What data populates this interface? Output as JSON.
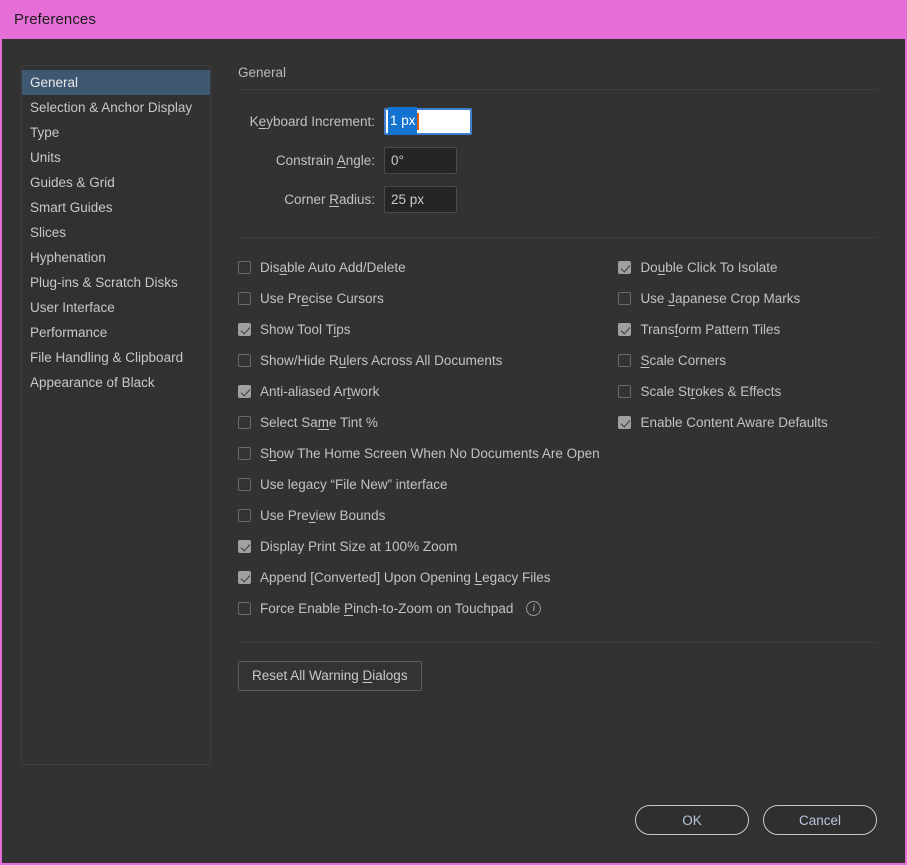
{
  "window": {
    "title": "Preferences",
    "titlebar_color": "#e56fd6",
    "background_color": "#323232",
    "accent_selection_color": "#3f5872",
    "focus_border_color": "#3f7fd0",
    "text_selection_color": "#1472d0",
    "caret_color": "#e06010"
  },
  "sidebar": {
    "items": [
      {
        "label": "General",
        "selected": true
      },
      {
        "label": "Selection & Anchor Display",
        "selected": false
      },
      {
        "label": "Type",
        "selected": false
      },
      {
        "label": "Units",
        "selected": false
      },
      {
        "label": "Guides & Grid",
        "selected": false
      },
      {
        "label": "Smart Guides",
        "selected": false
      },
      {
        "label": "Slices",
        "selected": false
      },
      {
        "label": "Hyphenation",
        "selected": false
      },
      {
        "label": "Plug-ins & Scratch Disks",
        "selected": false
      },
      {
        "label": "User Interface",
        "selected": false
      },
      {
        "label": "Performance",
        "selected": false
      },
      {
        "label": "File Handling & Clipboard",
        "selected": false
      },
      {
        "label": "Appearance of Black",
        "selected": false
      }
    ]
  },
  "pane": {
    "section_title": "General",
    "fields": [
      {
        "label_before": "K",
        "label_mnemonic": "e",
        "label_after": "yboard Increment:",
        "value": "1 px",
        "focused": true,
        "selected_text": "1 px"
      },
      {
        "label_before": "Constrain ",
        "label_mnemonic": "A",
        "label_after": "ngle:",
        "value": "0°",
        "focused": false
      },
      {
        "label_before": "Corner ",
        "label_mnemonic": "R",
        "label_after": "adius:",
        "value": "25 px",
        "focused": false
      }
    ],
    "checkboxes_left": [
      {
        "before": "Dis",
        "mnemonic": "a",
        "after": "ble Auto Add/Delete",
        "checked": false
      },
      {
        "before": "Use Pr",
        "mnemonic": "e",
        "after": "cise Cursors",
        "checked": false
      },
      {
        "before": "Show Tool T",
        "mnemonic": "i",
        "after": "ps",
        "checked": true
      },
      {
        "before": "Show/Hide R",
        "mnemonic": "u",
        "after": "lers Across All Documents",
        "checked": false
      },
      {
        "before": "Anti-aliased Ar",
        "mnemonic": "t",
        "after": "work",
        "checked": true
      },
      {
        "before": "Select Sa",
        "mnemonic": "m",
        "after": "e Tint %",
        "checked": false
      },
      {
        "before": "S",
        "mnemonic": "h",
        "after": "ow The Home Screen When No Documents Are Open",
        "checked": false
      },
      {
        "before": "Use legacy “File New” interface",
        "mnemonic": "",
        "after": "",
        "checked": false
      },
      {
        "before": "Use Pre",
        "mnemonic": "v",
        "after": "iew Bounds",
        "checked": false
      },
      {
        "before": "Display Print Size at 100% Zoom",
        "mnemonic": "",
        "after": "",
        "checked": true
      },
      {
        "before": "Append [Converted] Upon Opening ",
        "mnemonic": "L",
        "after": "egacy Files",
        "checked": true
      },
      {
        "before": "Force Enable ",
        "mnemonic": "P",
        "after": "inch-to-Zoom on Touchpad",
        "checked": false,
        "info_icon": "info-icon",
        "info_glyph": "i"
      }
    ],
    "checkboxes_right": [
      {
        "before": "Do",
        "mnemonic": "u",
        "after": "ble Click To Isolate",
        "checked": true
      },
      {
        "before": "Use ",
        "mnemonic": "J",
        "after": "apanese Crop Marks",
        "checked": false
      },
      {
        "before": "Trans",
        "mnemonic": "f",
        "after": "orm Pattern Tiles",
        "checked": true
      },
      {
        "before": "",
        "mnemonic": "S",
        "after": "cale Corners",
        "checked": false
      },
      {
        "before": "Scale St",
        "mnemonic": "r",
        "after": "okes & Effects",
        "checked": false
      },
      {
        "before": "Enable Content Aware Defaults",
        "mnemonic": "",
        "after": "",
        "checked": true
      }
    ],
    "reset_button": {
      "before": "Reset All Warning ",
      "mnemonic": "D",
      "after": "ialogs"
    }
  },
  "footer": {
    "ok_label": "OK",
    "cancel_label": "Cancel"
  }
}
